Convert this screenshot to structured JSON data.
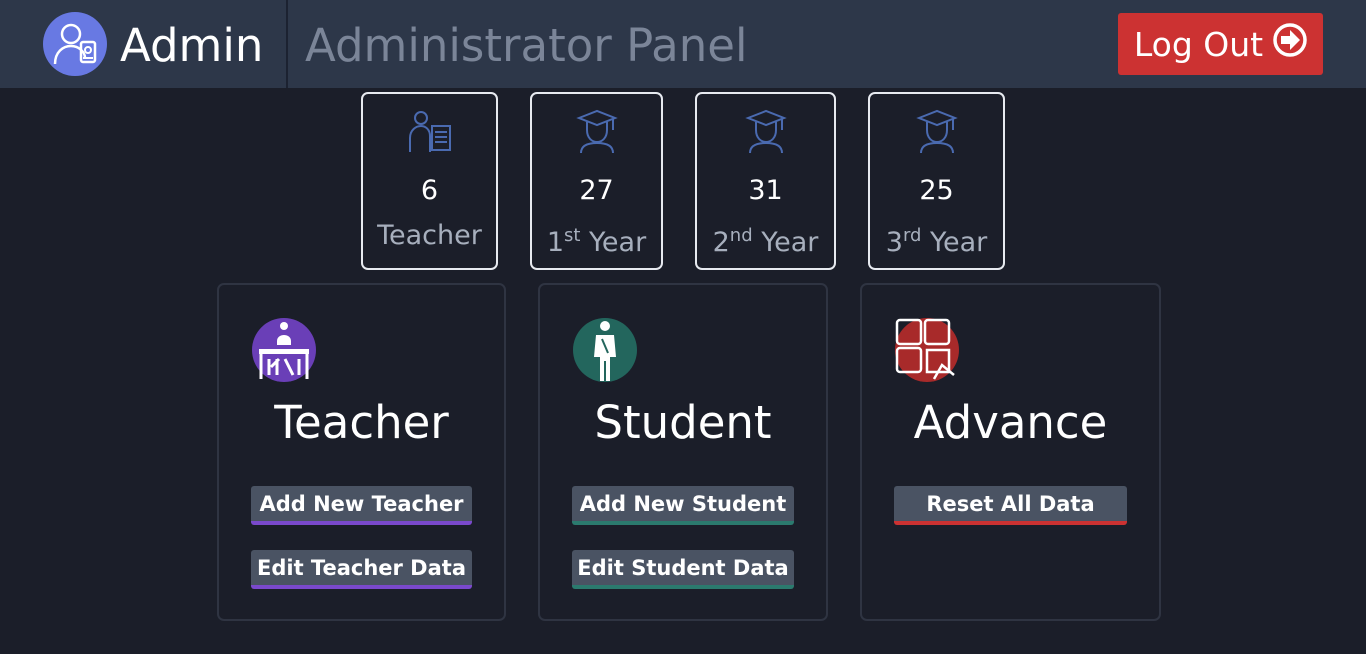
{
  "header": {
    "brand": "Admin",
    "panel_title": "Administrator Panel",
    "logout_label": "Log Out"
  },
  "stats": [
    {
      "icon": "teacher-icon",
      "value": "6",
      "label": "Teacher",
      "sup": ""
    },
    {
      "icon": "graduate-icon",
      "value": "27",
      "label_num": "1",
      "sup": "st",
      "label_rest": " Year"
    },
    {
      "icon": "graduate-icon",
      "value": "31",
      "label_num": "2",
      "sup": "nd",
      "label_rest": " Year"
    },
    {
      "icon": "graduate-icon",
      "value": "25",
      "label_num": "3",
      "sup": "rd",
      "label_rest": " Year"
    }
  ],
  "cards": {
    "teacher": {
      "title": "Teacher",
      "accent": "#7a49cc",
      "icon": "teacher-desk-icon",
      "buttons": [
        "Add New Teacher",
        "Edit Teacher Data"
      ]
    },
    "student": {
      "title": "Student",
      "accent": "#2b7a6e",
      "icon": "student-icon",
      "buttons": [
        "Add New Student",
        "Edit Student Data"
      ]
    },
    "advance": {
      "title": "Advance",
      "accent": "#cc3232",
      "icon": "puzzle-icon",
      "buttons": [
        "Reset All Data"
      ]
    }
  },
  "colors": {
    "background": "#1b1e29",
    "header": "#2d3749",
    "avatar": "#6879e3",
    "logout": "#cc3232",
    "button": "#4a5363"
  }
}
